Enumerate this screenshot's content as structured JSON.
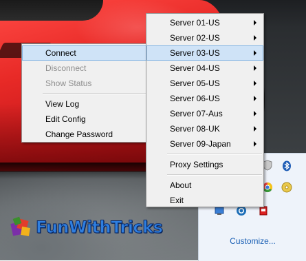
{
  "desktop": {
    "watermark": "FunWithTricks"
  },
  "tray": {
    "icons": [
      "bluetooth-icon",
      "shield-icon",
      "cd-icon",
      "gear-icon",
      "network-icon",
      "app-icon",
      "security-icon"
    ],
    "customize_label": "Customize..."
  },
  "left_menu": {
    "items": [
      {
        "label": "Connect",
        "state": "highlighted"
      },
      {
        "label": "Disconnect",
        "state": "disabled"
      },
      {
        "label": "Show Status",
        "state": "disabled"
      },
      {
        "label": "View Log",
        "state": "normal"
      },
      {
        "label": "Edit Config",
        "state": "normal"
      },
      {
        "label": "Change Password",
        "state": "normal"
      }
    ]
  },
  "right_menu": {
    "servers": [
      {
        "label": "Server 01-US"
      },
      {
        "label": "Server 02-US"
      },
      {
        "label": "Server 03-US",
        "state": "highlighted"
      },
      {
        "label": "Server 04-US"
      },
      {
        "label": "Server 05-US"
      },
      {
        "label": "Server 06-US"
      },
      {
        "label": "Server 07-Aus"
      },
      {
        "label": "Server 08-UK"
      },
      {
        "label": "Server 09-Japan"
      }
    ],
    "proxy_settings": "Proxy Settings",
    "about": "About",
    "exit": "Exit"
  },
  "colors": {
    "menu_bg": "#f0f0f0",
    "highlight_bg": "#cfe3f7",
    "highlight_border": "#7fb2e3",
    "disabled_text": "#8d8d8d",
    "link": "#1a5fb4",
    "car_red": "#e82a27"
  }
}
